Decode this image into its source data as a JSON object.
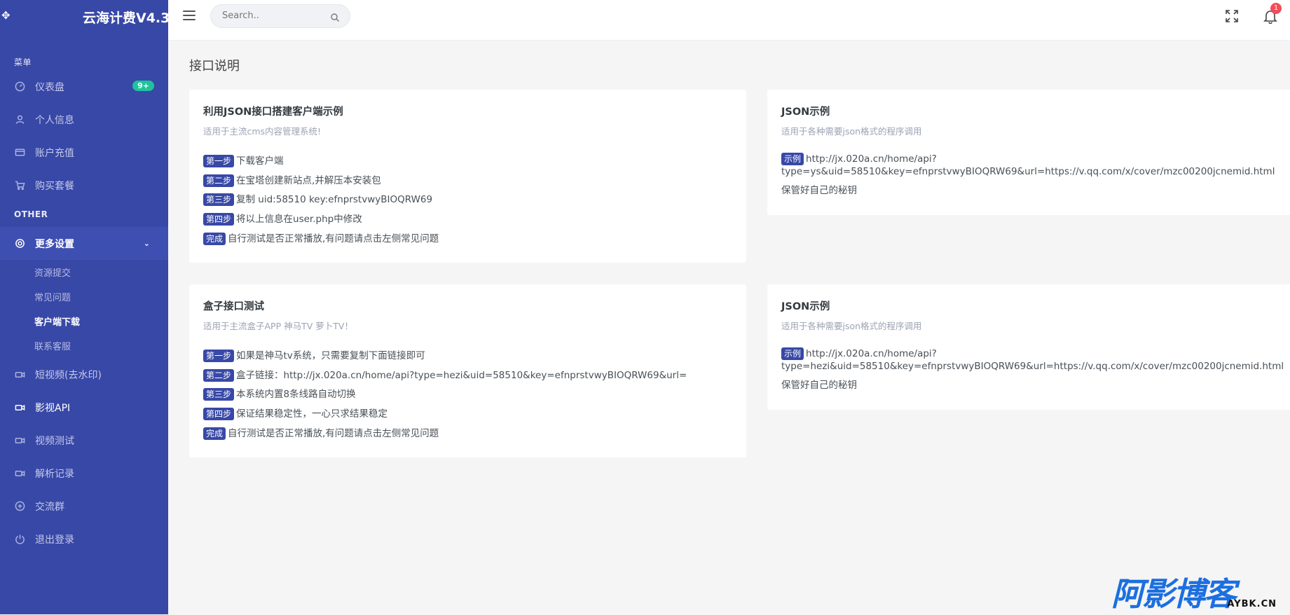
{
  "brand": {
    "name": "云海计费V4.3"
  },
  "sidebar": {
    "menu_title": "菜单",
    "items": [
      {
        "label": "仪表盘",
        "icon": "dashboard-icon",
        "badge": "9+"
      },
      {
        "label": "个人信息",
        "icon": "user-icon"
      },
      {
        "label": "账户充值",
        "icon": "credit-card-icon"
      },
      {
        "label": "购买套餐",
        "icon": "cart-icon"
      }
    ],
    "other_title": "OTHER",
    "more_settings": {
      "label": "更多设置",
      "icon": "gear-icon"
    },
    "sub_items": [
      {
        "label": "资源提交"
      },
      {
        "label": "常见问题"
      },
      {
        "label": "客户端下载"
      },
      {
        "label": "联系客服"
      }
    ],
    "items2": [
      {
        "label": "短视频(去水印)",
        "icon": "video-icon"
      },
      {
        "label": "影视API",
        "icon": "video-icon"
      },
      {
        "label": "视频测试",
        "icon": "video-icon"
      },
      {
        "label": "解析记录",
        "icon": "video-icon"
      },
      {
        "label": "交流群",
        "icon": "plus-circle-icon"
      },
      {
        "label": "退出登录",
        "icon": "power-icon"
      }
    ]
  },
  "topbar": {
    "search_placeholder": "Search..",
    "notification_count": "1"
  },
  "page": {
    "title": "接口说明"
  },
  "cards": {
    "json_client": {
      "title": "利用JSON接口搭建客户端示例",
      "subtitle": "适用于主流cms内容管理系统!",
      "steps": [
        {
          "tag": "第一步",
          "text": "下载客户端"
        },
        {
          "tag": "第二步",
          "text": "在宝塔创建新站点,并解压本安装包"
        },
        {
          "tag": "第三步",
          "text": "复制 uid:58510 key:efnprstvwyBIOQRW69"
        },
        {
          "tag": "第四步",
          "text": "将以上信息在user.php中修改"
        },
        {
          "tag": "完成",
          "text": "自行测试是否正常播放,有问题请点击左侧常见问题"
        }
      ]
    },
    "json_example_1": {
      "title": "JSON示例",
      "subtitle": "适用于各种需要json格式的程序调用",
      "tag": "示例",
      "line1": "http://jx.020a.cn/home/api?",
      "line2": "type=ys&uid=58510&key=efnprstvwyBIOQRW69&url=https://v.qq.com/x/cover/mzc00200jcnemid.html",
      "note": "保管好自己的秘钥"
    },
    "box_test": {
      "title": "盒子接口测试",
      "subtitle": "适用于主流盒子APP 神马TV 萝卜TV！",
      "steps": [
        {
          "tag": "第一步",
          "text": "如果是神马tv系统，只需要复制下面链接即可"
        },
        {
          "tag": "第二步",
          "text": "盒子链接：http://jx.020a.cn/home/api?type=hezi&uid=58510&key=efnprstvwyBIOQRW69&url="
        },
        {
          "tag": "第三步",
          "text": "本系统内置8条线路自动切换"
        },
        {
          "tag": "第四步",
          "text": "保证结果稳定性，一心只求结果稳定"
        },
        {
          "tag": "完成",
          "text": "自行测试是否正常播放,有问题请点击左侧常见问题"
        }
      ]
    },
    "json_example_2": {
      "title": "JSON示例",
      "subtitle": "适用于各种需要json格式的程序调用",
      "tag": "示例",
      "line1": "http://jx.020a.cn/home/api?",
      "line2": "type=hezi&uid=58510&key=efnprstvwyBIOQRW69&url=https://v.qq.com/x/cover/mzc00200jcnemid.html",
      "note": "保管好自己的秘钥"
    }
  },
  "watermark": {
    "big": "阿影博客",
    "small": "AYBK.CN"
  },
  "colors": {
    "sidebar": "#3848a7",
    "accent": "#3848a7",
    "badge_green": "#1fc39b",
    "badge_red": "#f44b57"
  }
}
